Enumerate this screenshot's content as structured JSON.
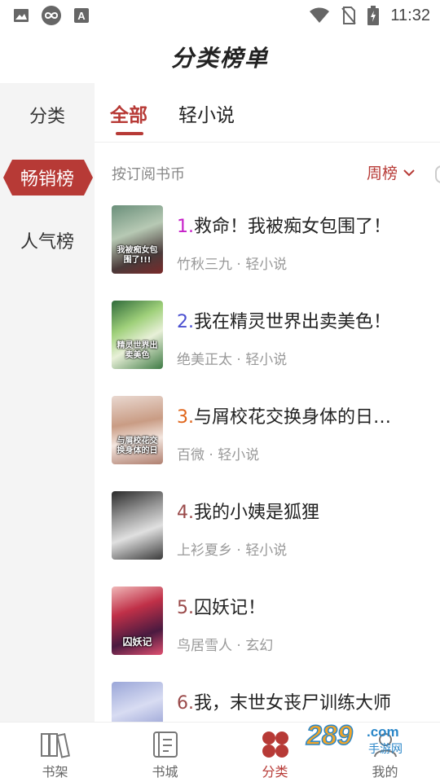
{
  "status_bar": {
    "time": "11:32",
    "icons": [
      "gallery-notification-icon",
      "infinity-app-icon",
      "font-app-icon",
      "wifi-icon",
      "no-sim-icon",
      "battery-charging-icon"
    ]
  },
  "header": {
    "title": "分类榜单"
  },
  "sidebar": {
    "items": [
      {
        "label": "分类",
        "active": false
      },
      {
        "label": "畅销榜",
        "active": true
      },
      {
        "label": "人气榜",
        "active": false
      }
    ]
  },
  "tabs": [
    {
      "label": "全部",
      "active": true
    },
    {
      "label": "轻小说",
      "active": false
    }
  ],
  "filter": {
    "label": "按订阅书币",
    "period": "周榜",
    "period_icon": "chevron-down-icon"
  },
  "books": [
    {
      "rank": "1.",
      "title": "救命！我被痴女包围了！",
      "author": "竹秋三九",
      "category": "轻小说",
      "rank_color": "#c61fc8",
      "cover_text": "我被痴女包围了!!!"
    },
    {
      "rank": "2.",
      "title": "我在精灵世界出卖美色！",
      "author": "绝美正太",
      "category": "轻小说",
      "rank_color": "#4a4fd0",
      "cover_text": "精灵世界出卖美色"
    },
    {
      "rank": "3.",
      "title": "与屑校花交换身体的日…",
      "author": "百微",
      "category": "轻小说",
      "rank_color": "#e0661c",
      "cover_text": "与屑校花交换身体的日"
    },
    {
      "rank": "4.",
      "title": "我的小姨是狐狸",
      "author": "上衫夏乡",
      "category": "轻小说",
      "rank_color": "#9a4a4a",
      "cover_text": ""
    },
    {
      "rank": "5.",
      "title": "囚妖记！",
      "author": "鸟居雪人",
      "category": "玄幻",
      "rank_color": "#9a4a4a",
      "cover_text": "囚妖记"
    },
    {
      "rank": "6.",
      "title": "我，末世女丧尸训练大师",
      "author": "",
      "category": "",
      "rank_color": "#9a4a4a",
      "cover_text": ""
    }
  ],
  "meta_separator": "·",
  "bottom_nav": [
    {
      "label": "书架",
      "icon": "bookshelf-icon",
      "active": false
    },
    {
      "label": "书城",
      "icon": "bookstore-icon",
      "active": false
    },
    {
      "label": "分类",
      "icon": "category-icon",
      "active": true
    },
    {
      "label": "我的",
      "icon": "profile-icon",
      "active": false
    }
  ],
  "watermark": {
    "text": "289手游网",
    "logo": "289.com"
  },
  "colors": {
    "accent": "#b73a36",
    "sidebar_bg": "#f4f4f4"
  }
}
